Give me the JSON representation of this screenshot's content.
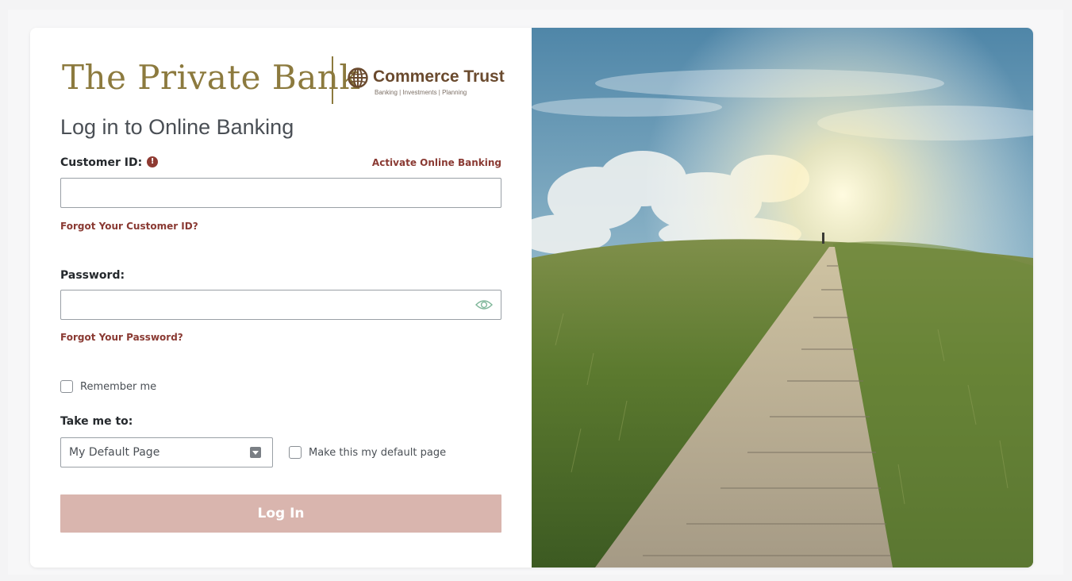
{
  "logo": {
    "main_text": "The Private Bank",
    "brand_text": "Commerce Trust",
    "brand_subtitle": "Banking | Investments | Planning"
  },
  "heading": "Log in to Online Banking",
  "customer_id": {
    "label": "Customer ID:",
    "info_icon": "info-icon",
    "info_glyph": "!",
    "value": "",
    "activate_link": "Activate Online Banking",
    "forgot_link": "Forgot Your Customer ID?"
  },
  "password": {
    "label": "Password:",
    "value": "",
    "toggle_icon": "eye-icon",
    "forgot_link": "Forgot Your Password?"
  },
  "remember": {
    "label": "Remember me",
    "checked": false
  },
  "take_me_to": {
    "label": "Take me to:",
    "selected": "My Default Page",
    "default_label": "Make this my default page",
    "default_checked": false
  },
  "login_button": "Log In",
  "colors": {
    "brand_gold": "#8c7a3e",
    "link_red": "#8a3a33",
    "button_disabled": "#d9b5ae",
    "eye_icon": "#7fb79a"
  },
  "hero_image": "boardwalk path through grassy dunes toward sunlight"
}
